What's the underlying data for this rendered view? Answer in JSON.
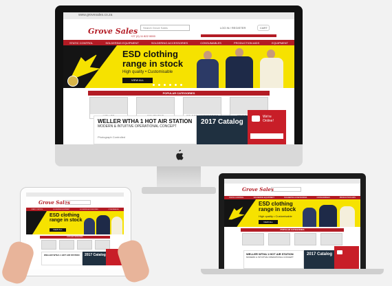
{
  "site": {
    "url": "www.grovesales.co.za",
    "search_placeholder": "Search Grove Sales",
    "logo_main": "Grove Sales",
    "logo_sub": "(Pty) Ltd",
    "phone": "+27 (0) 11 822 0000",
    "top_links": [
      "LOG IN / REGISTER",
      "CART"
    ],
    "nav": [
      "STATIC CONTROL",
      "SOLDERING EQUIPMENT",
      "SOLDERING ACCESSORIES",
      "CONSUMABLES",
      "PRODUCTION AIDS",
      "EQUIPMENT"
    ],
    "banner_title_line1": "ESD clothing",
    "banner_title_line2": "range in stock",
    "banner_subtitle": "High quality • Customisable",
    "banner_button": "VIEW ALL",
    "popular_categories_title": "POPULAR CATEGORIES",
    "categories": [
      "WELLER",
      "EQUIPMENT",
      "SOLDER ACCESSORIES",
      "STATIC CONTROL"
    ],
    "promo_title": "WELLER WTHA 1 HOT AIR STATION",
    "promo_subtitle": "MODERN & INTUITIVE OPERATIONAL CONCEPT",
    "promo_note": "Photograph Controlled",
    "catalog_text": "2017 Catalog",
    "chat_label_line1": "We're",
    "chat_label_line2": "Online!",
    "chat_prompt": "Talk to us!",
    "chat_cta": "Chat Now"
  },
  "colors": {
    "brand_red": "#b31b24",
    "banner_yellow": "#f6e200",
    "catalog_navy": "#1f3040"
  },
  "icons": {
    "apple_logo": "apple-icon",
    "chat": "chat-icon"
  }
}
